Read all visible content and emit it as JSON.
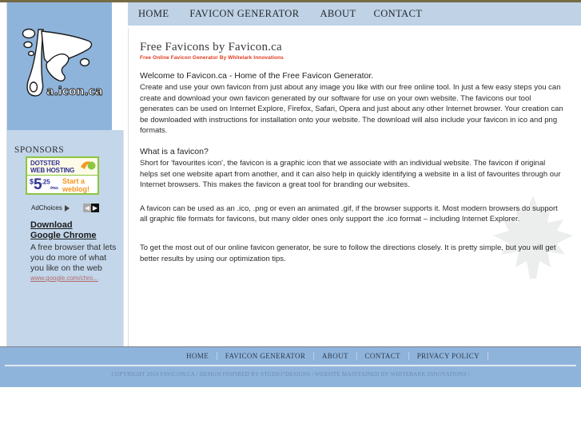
{
  "theme": {
    "top_rule_color": "#756b44",
    "nav_bg": "#bfd2e6",
    "panel_blue": "#8fb4dc",
    "sidebar_blue": "#c3d6ea",
    "tagline_red": "#e03a1e",
    "ad_border_green": "#8dc63f",
    "ad_text_blue": "#2f3192",
    "ad_cta_orange": "#f7941e",
    "copyright_color": "#6c8bb0"
  },
  "logo": {
    "name": "favicon-ca-logo",
    "wordmark": "a.icon.ca"
  },
  "topnav": {
    "items": [
      {
        "label": "HOME",
        "name": "nav-home"
      },
      {
        "label": "FAVICON GENERATOR",
        "name": "nav-favicon-generator"
      },
      {
        "label": "ABOUT",
        "name": "nav-about"
      },
      {
        "label": "CONTACT",
        "name": "nav-contact"
      }
    ]
  },
  "sidebar": {
    "sponsors_heading": "SPONSORS",
    "dotster_ad": {
      "line1": "DOTSTER",
      "line2": "WEB HOSTING",
      "dollar": "$",
      "price": "5",
      "cents": ".25",
      "per": "/mo.",
      "cta_line1": "Start a",
      "cta_line2": "weblog!"
    },
    "adchoices_label": "AdChoices",
    "prev_arrow": "◀",
    "next_arrow": "▶",
    "chrome_ad": {
      "headline_line1": "Download",
      "headline_line2": "Google Chrome",
      "body": "A free browser that lets you do more of what you like on the web",
      "url": "www.google.com/chro..."
    }
  },
  "main": {
    "title": "Free Favicons by Favicon.ca",
    "tagline": "Free Online Favicon Generator By Whitelark Innovations",
    "welcome_heading": "Welcome to Favicon.ca - Home of the Free Favicon Generator.",
    "welcome_body": "Create and use your own favicon from just about any image you like with our free online tool. In just a few easy steps you can create and download your own favicon generated by our software for use on your own website. The favicons our tool generates can be used on Internet Explore, Firefox, Safari, Opera and just about any other Internet browser. Your creation can be downloaded with instructions for installation onto your website. The download will also include your favicon in ico and png formats.",
    "what_heading": "What is a favicon?",
    "what_body": "Short for 'favourites icon', the favicon is a graphic icon that we associate with an individual website. The favicon if original helps set one website apart from another, and it can also help in quickly identifying a website in a list of favourites through our Internet browsers. This makes the favicon a great tool for branding our websites.",
    "formats_body": "A favicon can be used as an .ico, .png or even an animated .gif, if the browser supports it. Most modern browsers do support all graphic file formats for favicons, but many older ones only support the .ico format – including Internet Explorer.",
    "tips_body": "To get the most out of our online favicon generator, be sure to follow the directions closely. It is pretty simple, but you will get better results by using our optimization tips."
  },
  "footer": {
    "items": [
      {
        "label": "HOME",
        "name": "footer-home"
      },
      {
        "label": "FAVICON GENERATOR",
        "name": "footer-favicon-generator"
      },
      {
        "label": "ABOUT",
        "name": "footer-about"
      },
      {
        "label": "CONTACT",
        "name": "footer-contact"
      },
      {
        "label": "PRIVACY POLICY",
        "name": "footer-privacy-policy"
      }
    ],
    "separator": "|",
    "copyright": "COPYRIGHT 2010 FAVICON.CA | DESIGN INSPIRED BY STUDIO7DESIGNS | WEBSITE MAINTAINED BY WHITEBARK INNOVATIONS |"
  }
}
